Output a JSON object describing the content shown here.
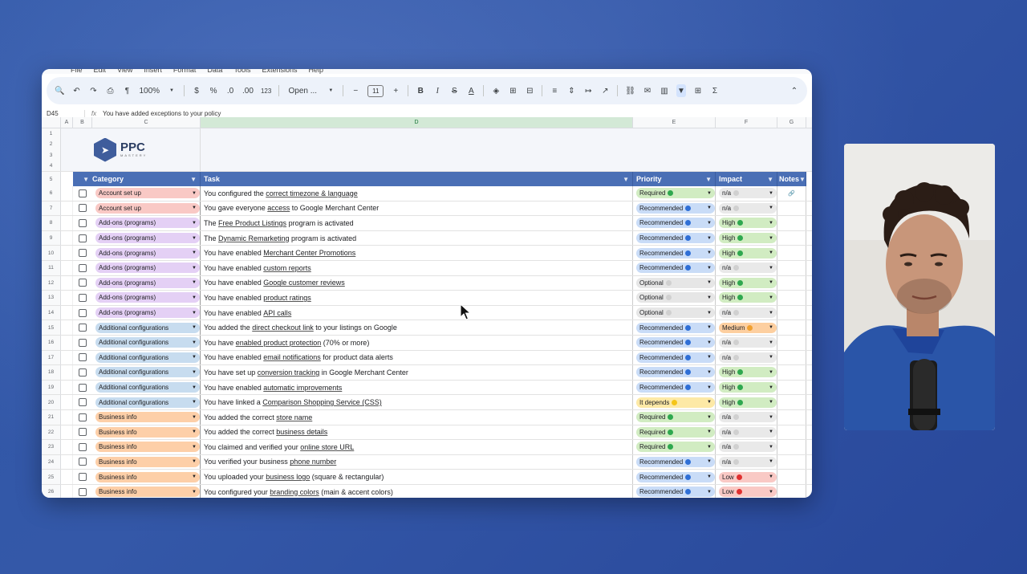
{
  "menu": [
    "File",
    "Edit",
    "View",
    "Insert",
    "Format",
    "Data",
    "Tools",
    "Extensions",
    "Help"
  ],
  "toolbar": {
    "zoom": "100%",
    "currency": "$",
    "percent": "%",
    "dec_less": ".0",
    "dec_more": ".00",
    "numfmt": "123",
    "font": "Open ...",
    "font_size": "11",
    "minus": "−",
    "plus": "+"
  },
  "formula": {
    "cellref": "D45",
    "fx": "fx",
    "content": "You have added exceptions to your policy"
  },
  "columns": {
    "a": "A",
    "b": "B",
    "c": "C",
    "d": "D",
    "e": "E",
    "f": "F",
    "g": "G"
  },
  "brand": {
    "name": "PPC",
    "sub": "MASTERY"
  },
  "header": {
    "category": "Category",
    "task": "Task",
    "priority": "Priority",
    "impact": "Impact",
    "notes": "Notes"
  },
  "row_numbers": [
    "1",
    "2",
    "3",
    "4",
    "5",
    "6",
    "7",
    "8",
    "9",
    "10",
    "11",
    "12",
    "13",
    "14",
    "15",
    "16",
    "17",
    "18",
    "19",
    "20",
    "21",
    "22",
    "23",
    "24",
    "25",
    "26"
  ],
  "colors": {
    "account": "#f9c9c5",
    "addons": "#e4d0f5",
    "additional": "#c7dcef",
    "business": "#fdcfa8",
    "recommended": "#c9dcf7",
    "required": "#d1ecc2",
    "optional": "#e6e6e6",
    "itdepends": "#fde9a6",
    "high": "#d1ecc2",
    "medium": "#fdcfa0",
    "low": "#f9c9c5",
    "na": "#e9e9e9"
  },
  "rows": [
    {
      "n": "6",
      "category": "Account set up",
      "cat": "account",
      "pre": "You configured the ",
      "link": "correct timezone & language",
      "post": "",
      "priority": "Required",
      "pr": "required",
      "pdot": "#2fa84f",
      "impact": "n/a",
      "im": "na",
      "idot": "#d0d0d0",
      "note": "🔗"
    },
    {
      "n": "7",
      "category": "Account set up",
      "cat": "account",
      "pre": "You gave everyone ",
      "link": "access",
      "post": " to Google Merchant Center",
      "priority": "Recommended",
      "pr": "recommended",
      "pdot": "#2f6fd6",
      "impact": "n/a",
      "im": "na",
      "idot": "#d0d0d0",
      "note": ""
    },
    {
      "n": "8",
      "category": "Add-ons (programs)",
      "cat": "addons",
      "pre": "The ",
      "link": "Free Product Listings",
      "post": " program is activated",
      "priority": "Recommended",
      "pr": "recommended",
      "pdot": "#2f6fd6",
      "impact": "High",
      "im": "high",
      "idot": "#2fa84f",
      "note": ""
    },
    {
      "n": "9",
      "category": "Add-ons (programs)",
      "cat": "addons",
      "pre": "The ",
      "link": "Dynamic Remarketing",
      "post": " program is activated",
      "priority": "Recommended",
      "pr": "recommended",
      "pdot": "#2f6fd6",
      "impact": "High",
      "im": "high",
      "idot": "#2fa84f",
      "note": ""
    },
    {
      "n": "10",
      "category": "Add-ons (programs)",
      "cat": "addons",
      "pre": "You have enabled ",
      "link": "Merchant Center Promotions",
      "post": "",
      "priority": "Recommended",
      "pr": "recommended",
      "pdot": "#2f6fd6",
      "impact": "High",
      "im": "high",
      "idot": "#2fa84f",
      "note": ""
    },
    {
      "n": "11",
      "category": "Add-ons (programs)",
      "cat": "addons",
      "pre": "You have enabled ",
      "link": "custom reports",
      "post": "",
      "priority": "Recommended",
      "pr": "recommended",
      "pdot": "#2f6fd6",
      "impact": "n/a",
      "im": "na",
      "idot": "#d0d0d0",
      "note": ""
    },
    {
      "n": "12",
      "category": "Add-ons (programs)",
      "cat": "addons",
      "pre": "You have enabled ",
      "link": "Google customer reviews",
      "post": "",
      "priority": "Optional",
      "pr": "optional",
      "pdot": "#d0d0d0",
      "impact": "High",
      "im": "high",
      "idot": "#2fa84f",
      "note": ""
    },
    {
      "n": "13",
      "category": "Add-ons (programs)",
      "cat": "addons",
      "pre": "You have enabled ",
      "link": "product ratings",
      "post": "",
      "priority": "Optional",
      "pr": "optional",
      "pdot": "#d0d0d0",
      "impact": "High",
      "im": "high",
      "idot": "#2fa84f",
      "note": ""
    },
    {
      "n": "14",
      "category": "Add-ons (programs)",
      "cat": "addons",
      "pre": "You have enabled ",
      "link": "API calls",
      "post": "",
      "priority": "Optional",
      "pr": "optional",
      "pdot": "#d0d0d0",
      "impact": "n/a",
      "im": "na",
      "idot": "#d0d0d0",
      "note": ""
    },
    {
      "n": "15",
      "category": "Additional configurations",
      "cat": "additional",
      "pre": "You added the ",
      "link": "direct checkout link",
      "post": " to your listings on Google",
      "priority": "Recommended",
      "pr": "recommended",
      "pdot": "#2f6fd6",
      "impact": "Medium",
      "im": "medium",
      "idot": "#f0a030",
      "note": ""
    },
    {
      "n": "16",
      "category": "Additional configurations",
      "cat": "additional",
      "pre": "You have ",
      "link": "enabled product protection",
      "post": " (70% or more)",
      "priority": "Recommended",
      "pr": "recommended",
      "pdot": "#2f6fd6",
      "impact": "n/a",
      "im": "na",
      "idot": "#d0d0d0",
      "note": ""
    },
    {
      "n": "17",
      "category": "Additional configurations",
      "cat": "additional",
      "pre": "You have enabled ",
      "link": "email notifications",
      "post": " for product data alerts",
      "priority": "Recommended",
      "pr": "recommended",
      "pdot": "#2f6fd6",
      "impact": "n/a",
      "im": "na",
      "idot": "#d0d0d0",
      "note": ""
    },
    {
      "n": "18",
      "category": "Additional configurations",
      "cat": "additional",
      "pre": "You have set up ",
      "link": "conversion tracking",
      "post": " in Google Merchant Center",
      "priority": "Recommended",
      "pr": "recommended",
      "pdot": "#2f6fd6",
      "impact": "High",
      "im": "high",
      "idot": "#2fa84f",
      "note": ""
    },
    {
      "n": "19",
      "category": "Additional configurations",
      "cat": "additional",
      "pre": "You have enabled ",
      "link": "automatic improvements",
      "post": "",
      "priority": "Recommended",
      "pr": "recommended",
      "pdot": "#2f6fd6",
      "impact": "High",
      "im": "high",
      "idot": "#2fa84f",
      "note": ""
    },
    {
      "n": "20",
      "category": "Additional configurations",
      "cat": "additional",
      "pre": "You have linked a ",
      "link": "Comparison Shopping Service (CSS)",
      "post": "",
      "priority": "It depends",
      "pr": "itdepends",
      "pdot": "#f5c518",
      "impact": "High",
      "im": "high",
      "idot": "#2fa84f",
      "note": ""
    },
    {
      "n": "21",
      "category": "Business info",
      "cat": "business",
      "pre": "You added the correct ",
      "link": "store name",
      "post": "",
      "priority": "Required",
      "pr": "required",
      "pdot": "#2fa84f",
      "impact": "n/a",
      "im": "na",
      "idot": "#d0d0d0",
      "note": ""
    },
    {
      "n": "22",
      "category": "Business info",
      "cat": "business",
      "pre": "You added the correct ",
      "link": "business details",
      "post": "",
      "priority": "Required",
      "pr": "required",
      "pdot": "#2fa84f",
      "impact": "n/a",
      "im": "na",
      "idot": "#d0d0d0",
      "note": ""
    },
    {
      "n": "23",
      "category": "Business info",
      "cat": "business",
      "pre": "You claimed and verified your ",
      "link": "online store URL",
      "post": "",
      "priority": "Required",
      "pr": "required",
      "pdot": "#2fa84f",
      "impact": "n/a",
      "im": "na",
      "idot": "#d0d0d0",
      "note": ""
    },
    {
      "n": "24",
      "category": "Business info",
      "cat": "business",
      "pre": "You verified your business ",
      "link": "phone number",
      "post": "",
      "priority": "Recommended",
      "pr": "recommended",
      "pdot": "#2f6fd6",
      "impact": "n/a",
      "im": "na",
      "idot": "#d0d0d0",
      "note": ""
    },
    {
      "n": "25",
      "category": "Business info",
      "cat": "business",
      "pre": "You uploaded your ",
      "link": "business logo",
      "post": " (square & rectangular)",
      "priority": "Recommended",
      "pr": "recommended",
      "pdot": "#2f6fd6",
      "impact": "Low",
      "im": "low",
      "idot": "#e03030",
      "note": ""
    },
    {
      "n": "26",
      "category": "Business info",
      "cat": "business",
      "pre": "You configured your ",
      "link": "branding colors",
      "post": " (main & accent colors)",
      "priority": "Recommended",
      "pr": "recommended",
      "pdot": "#2f6fd6",
      "impact": "Low",
      "im": "low",
      "idot": "#e03030",
      "note": ""
    }
  ]
}
